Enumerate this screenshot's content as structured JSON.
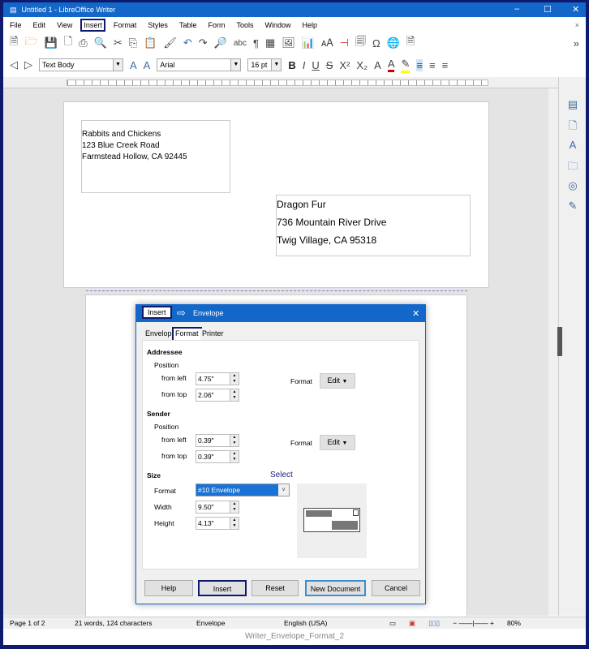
{
  "window": {
    "title": "Untitled 1 - LibreOffice Writer",
    "minimize": "–",
    "maximize": "☐",
    "close": "✕"
  },
  "menu": [
    "File",
    "Edit",
    "View",
    "Insert",
    "Format",
    "Styles",
    "Table",
    "Form",
    "Tools",
    "Window",
    "Help"
  ],
  "menu_close": "×",
  "toolbar": {
    "paragraph_style": "Text Body",
    "font_name": "Arial",
    "font_size": "16 pt"
  },
  "document": {
    "sender": [
      "Rabbits and Chickens",
      "123 Blue Creek Road",
      "Farmstead Hollow, CA 92445"
    ],
    "addressee": [
      "Dragon Fur",
      "736 Mountain River Drive",
      "Twig Village, CA 95318"
    ]
  },
  "dialog": {
    "breadcrumb": "Insert",
    "title": "Envelope",
    "close": "✕",
    "tabs": [
      "Envelope",
      "Format",
      "Printer"
    ],
    "addressee": {
      "heading": "Addressee",
      "position": "Position",
      "from_left_label": "from left",
      "from_left": "4.75\"",
      "from_top_label": "from top",
      "from_top": "2.06\"",
      "format_label": "Format",
      "edit": "Edit"
    },
    "sender": {
      "heading": "Sender",
      "position": "Position",
      "from_left_label": "from left",
      "from_left": "0.39\"",
      "from_top_label": "from top",
      "from_top": "0.39\"",
      "format_label": "Format",
      "edit": "Edit"
    },
    "size": {
      "heading": "Size",
      "annotation": "Select",
      "format_label": "Format",
      "format": "#10 Envelope",
      "width_label": "Width",
      "width": "9.50\"",
      "height_label": "Height",
      "height": "4.13\""
    },
    "buttons": {
      "help": "Help",
      "insert": "Insert",
      "reset": "Reset",
      "new_document": "New Document",
      "cancel": "Cancel"
    }
  },
  "status": {
    "page": "Page 1 of 2",
    "words": "21 words, 124 characters",
    "style": "Envelope",
    "language": "English (USA)",
    "zoom": "80%"
  },
  "caption": "Writer_Envelope_Format_2",
  "colors": {
    "titlebar": "#1267c9",
    "highlight": "#0d1a6e",
    "selection": "#1a73d4"
  }
}
